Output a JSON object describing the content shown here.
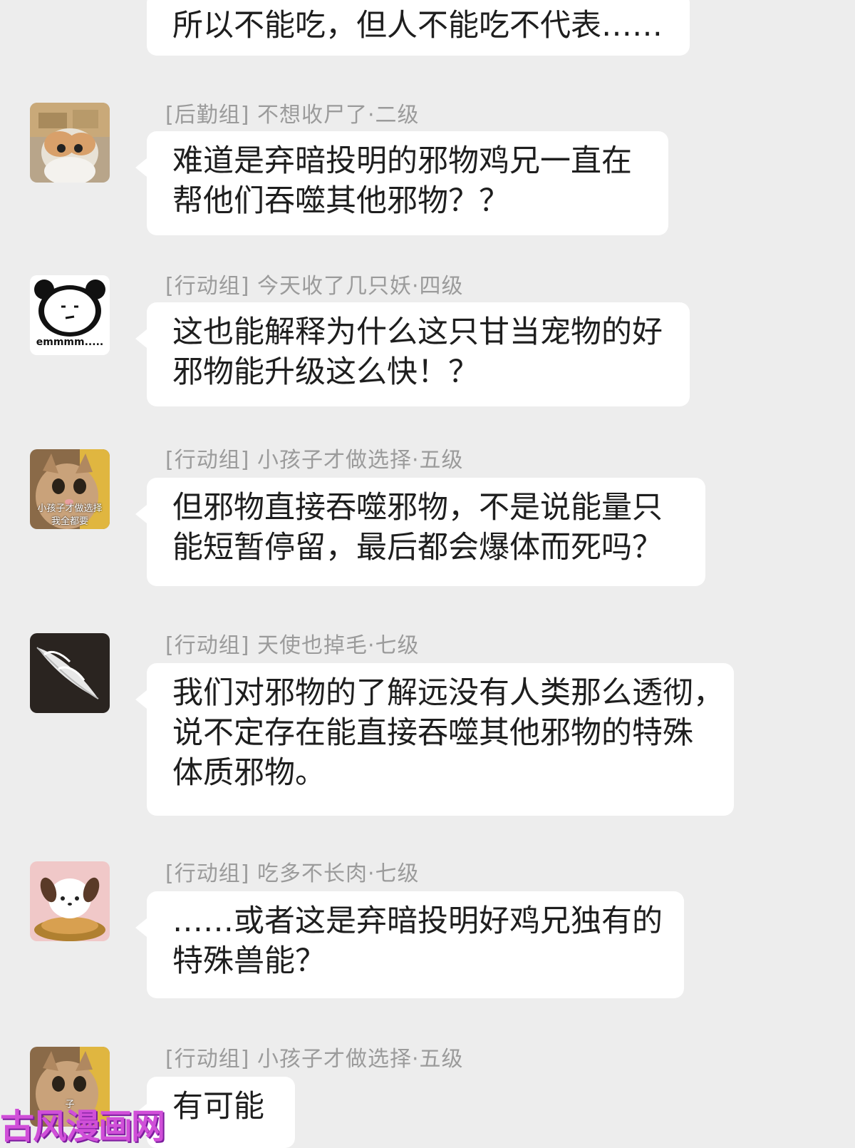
{
  "messages": [
    {
      "sender": "",
      "lines": [
        "所以不能吃，但人不能吃不代表……"
      ]
    },
    {
      "sender": "[后勤组] 不想收尸了·二级",
      "avatar": "kitten-in-box",
      "lines": [
        "难道是弃暗投明的邪物鸡兄一直在",
        "帮他们吞噬其他邪物？？"
      ]
    },
    {
      "sender": "[行动组] 今天收了几只妖·四级",
      "avatar": "panda-meme",
      "avatar_text": "emmmm.....",
      "lines": [
        "这也能解释为什么这只甘当宠物的好",
        "邪物能升级这么快！？"
      ]
    },
    {
      "sender": "[行动组] 小孩子才做选择·五级",
      "avatar": "cat-looking-up",
      "avatar_text": [
        "小孩子才做选择",
        "我全都要"
      ],
      "lines": [
        "但邪物直接吞噬邪物，不是说能量只",
        "能短暂停留，最后都会爆体而死吗？"
      ]
    },
    {
      "sender": "[行动组] 天使也掉毛·七级",
      "avatar": "white-feather",
      "lines": [
        "我们对邪物的了解远没有人类那么透彻，",
        "说不定存在能直接吞噬其他邪物的特殊",
        "体质邪物。"
      ]
    },
    {
      "sender": "[行动组] 吃多不长肉·七级",
      "avatar": "pochacco-dessert",
      "lines": [
        "……或者这是弃暗投明好鸡兄独有的",
        "特殊兽能？"
      ]
    },
    {
      "sender": "[行动组] 小孩子才做选择·五级",
      "avatar": "cat-looking-up",
      "avatar_text": [
        "子"
      ],
      "lines": [
        "有可能"
      ]
    }
  ],
  "watermark": "古风漫画网",
  "colors": {
    "background": "#ededed",
    "bubble": "#ffffff",
    "sender_text": "#9b9b9b",
    "message_text": "#1e1e1e",
    "watermark": "#d04fd8"
  }
}
